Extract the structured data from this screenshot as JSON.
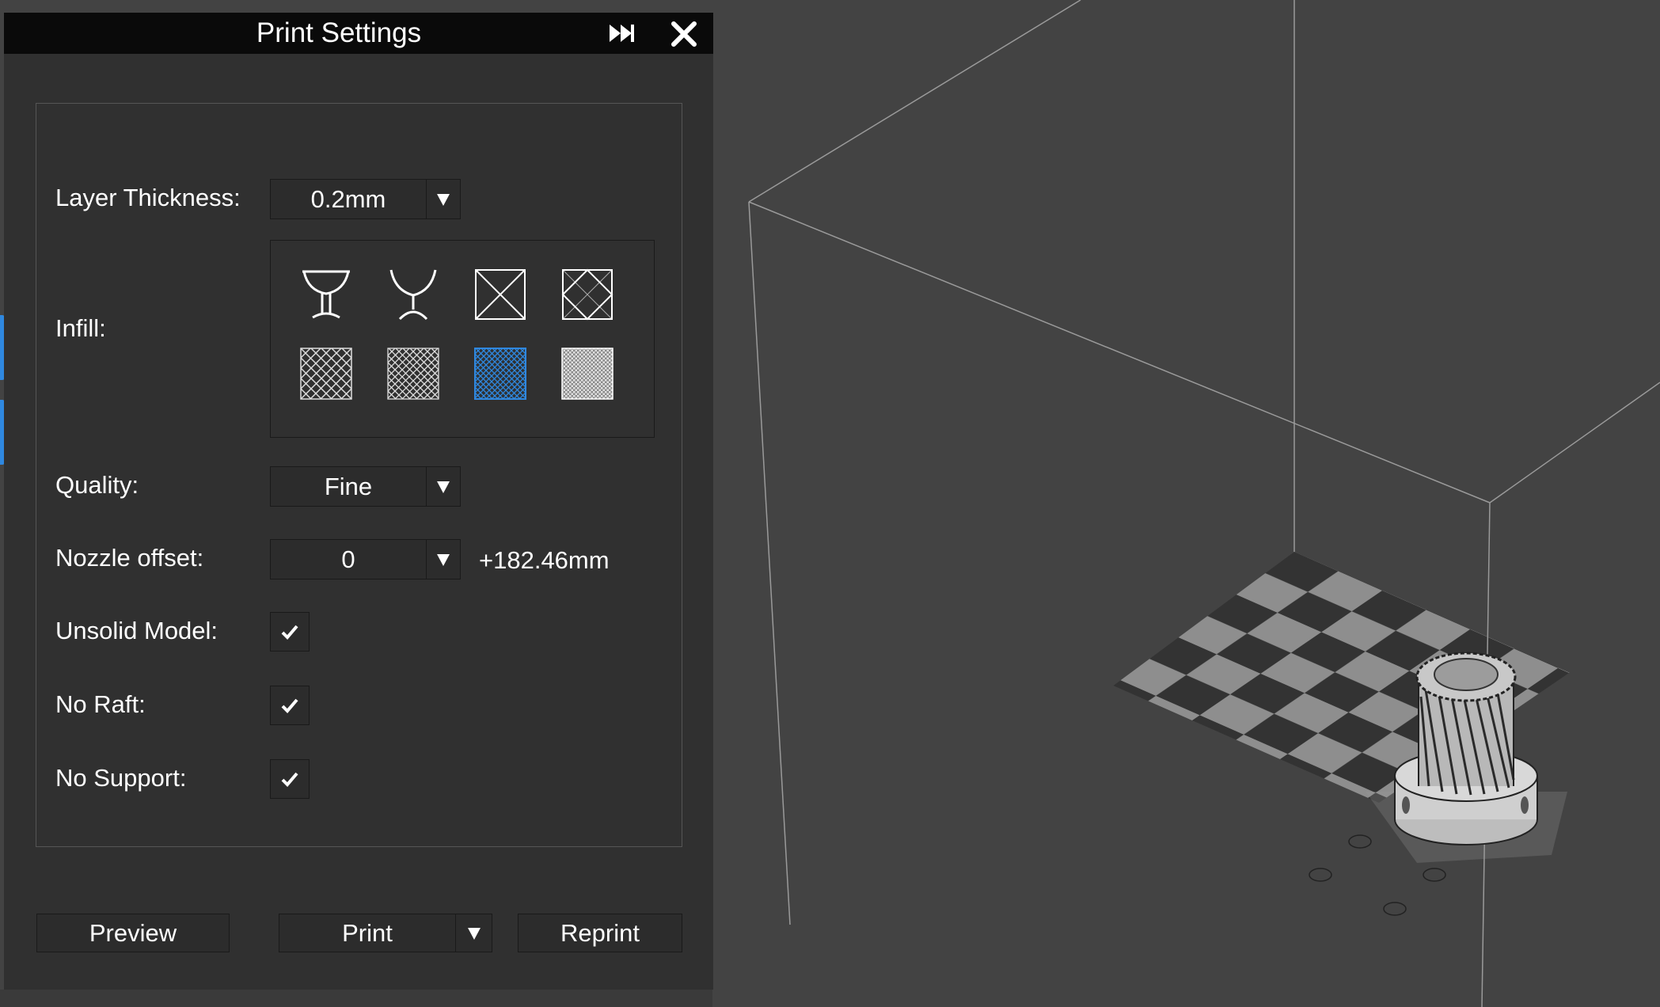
{
  "window": {
    "title": "Print Settings",
    "expand_icon": "fast-forward-icon",
    "close_icon": "close-icon"
  },
  "settings": {
    "layer_thickness": {
      "label": "Layer Thickness:",
      "value": "0.2mm"
    },
    "infill": {
      "label": "Infill:",
      "options": [
        {
          "icon": "goblet-solid-icon",
          "selected": false
        },
        {
          "icon": "goblet-hollow-icon",
          "selected": false
        },
        {
          "icon": "cross-infill-icon",
          "selected": false
        },
        {
          "icon": "diamond-infill-icon",
          "selected": false
        },
        {
          "icon": "sparse-grid-icon",
          "selected": false
        },
        {
          "icon": "medium-grid-icon",
          "selected": false
        },
        {
          "icon": "dense-grid-icon",
          "selected": true
        },
        {
          "icon": "solid-grid-icon",
          "selected": false
        }
      ]
    },
    "quality": {
      "label": "Quality:",
      "value": "Fine"
    },
    "nozzle_offset": {
      "label": "Nozzle offset:",
      "value": "0",
      "total": "+182.46mm"
    },
    "unsolid_model": {
      "label": "Unsolid Model:",
      "checked": true
    },
    "no_raft": {
      "label": "No Raft:",
      "checked": true
    },
    "no_support": {
      "label": "No Support:",
      "checked": true
    }
  },
  "buttons": {
    "preview": "Preview",
    "print": "Print",
    "reprint": "Reprint"
  },
  "colors": {
    "panel_bg": "#303030",
    "title_bar": "#0a0a0a",
    "viewport_bg": "#434343",
    "accent_blue": "#2f88e0",
    "build_plate_light": "#8e8e8e",
    "build_plate_dark": "#333333"
  }
}
